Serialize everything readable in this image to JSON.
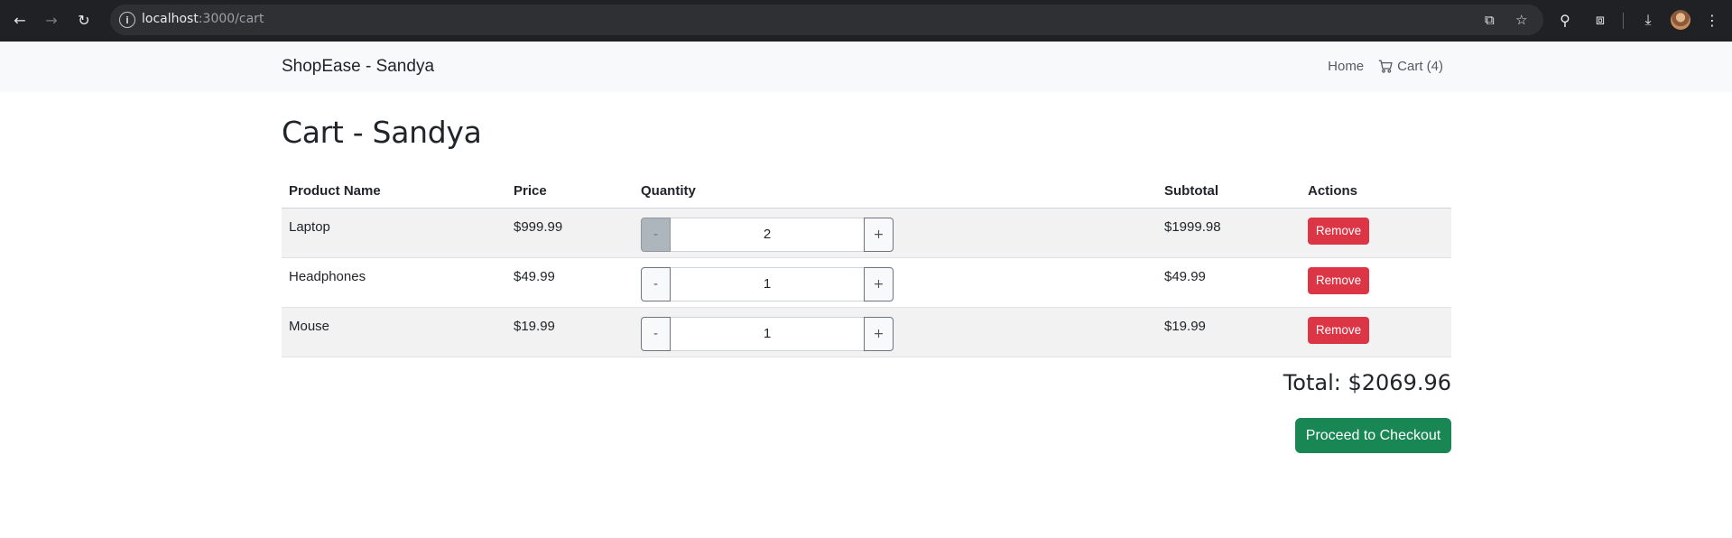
{
  "browser": {
    "url_host": "localhost",
    "url_path": ":3000/cart"
  },
  "navbar": {
    "brand": "ShopEase - Sandya",
    "home_label": "Home",
    "cart_label": "Cart (4)"
  },
  "page": {
    "title": "Cart - Sandya"
  },
  "table": {
    "headers": [
      "Product Name",
      "Price",
      "Quantity",
      "Subtotal",
      "Actions"
    ],
    "rows": [
      {
        "name": "Laptop",
        "price": "$999.99",
        "quantity": "2",
        "subtotal": "$1999.98",
        "action": "Remove",
        "minus": "-",
        "plus": "+"
      },
      {
        "name": "Headphones",
        "price": "$49.99",
        "quantity": "1",
        "subtotal": "$49.99",
        "action": "Remove",
        "minus": "-",
        "plus": "+"
      },
      {
        "name": "Mouse",
        "price": "$19.99",
        "quantity": "1",
        "subtotal": "$19.99",
        "action": "Remove",
        "minus": "-",
        "plus": "+"
      }
    ]
  },
  "summary": {
    "total": "Total: $2069.96",
    "checkout_label": "Proceed to Checkout"
  },
  "colors": {
    "danger": "#dc3545",
    "success": "#198754",
    "navbar_bg": "#f8f9fa"
  }
}
